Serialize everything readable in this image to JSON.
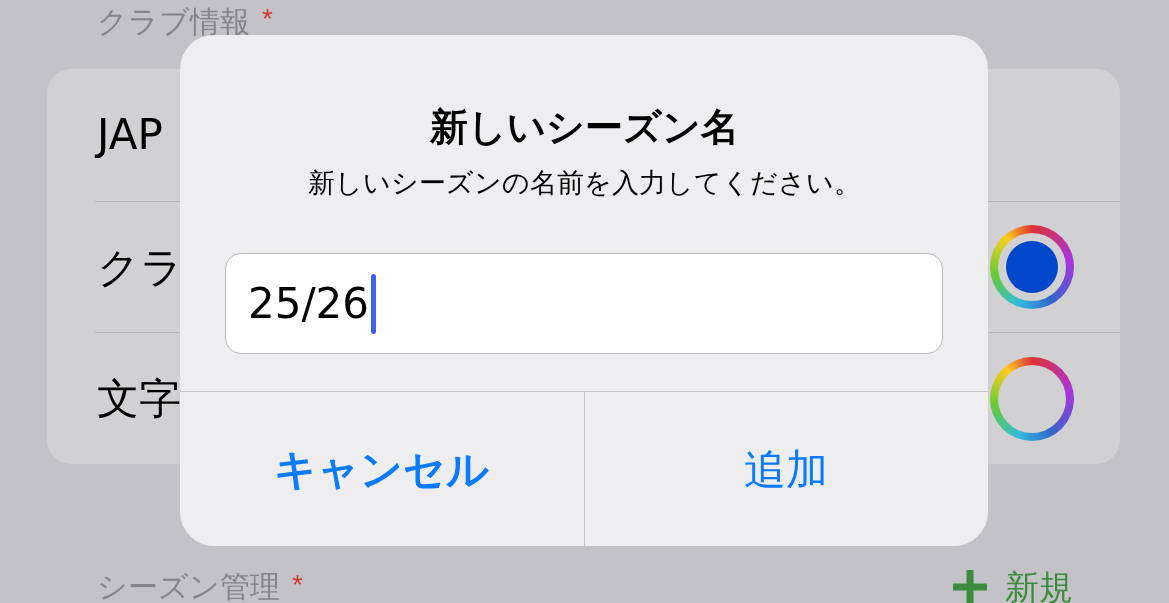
{
  "club_section": {
    "title": "クラブ情報",
    "required_mark": "*"
  },
  "rows": [
    {
      "kind": "text",
      "label": "JAP"
    },
    {
      "kind": "color",
      "label": "クラ",
      "color": "#0047cc"
    },
    {
      "kind": "color",
      "label": "文字"
    }
  ],
  "season_section": {
    "title": "シーズン管理",
    "required_mark": "*",
    "new_button": "新規"
  },
  "alert": {
    "title": "新しいシーズン名",
    "message": "新しいシーズンの名前を入力してください。",
    "field": {
      "value": "25/26"
    },
    "buttons": [
      {
        "label": "キャンセル",
        "kind": "cancel"
      },
      {
        "label": "追加",
        "kind": "default"
      }
    ]
  }
}
